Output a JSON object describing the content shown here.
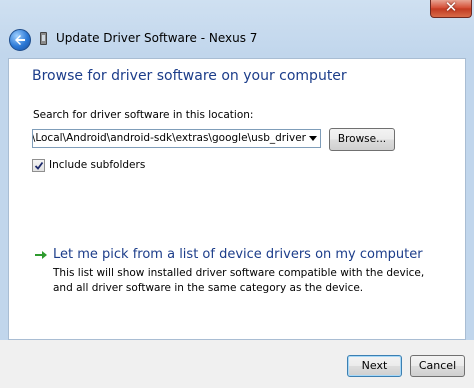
{
  "window": {
    "title": "Update Driver Software - Nexus 7"
  },
  "titlebar": {
    "close_glyph": "✕",
    "back_icon": "back-arrow-icon",
    "device_icon": "usb-device-icon"
  },
  "content": {
    "heading": "Browse for driver software on your computer",
    "search_label": "Search for driver software in this location:",
    "path_value": "pData\\Local\\Android\\android-sdk\\extras\\google\\usb_driver",
    "browse_label": "Browse...",
    "include_subfolders_label": "Include subfolders",
    "include_subfolders_checked": true,
    "pick_link": "Let me pick from a list of device drivers on my computer",
    "pick_description": "This list will show installed driver software compatible with the device, and all driver software in the same category as the device."
  },
  "footer": {
    "next_label": "Next",
    "cancel_label": "Cancel"
  },
  "colors": {
    "heading": "#1c3d8a",
    "link_arrow": "#2e9b2e",
    "close": "#c13a21"
  }
}
